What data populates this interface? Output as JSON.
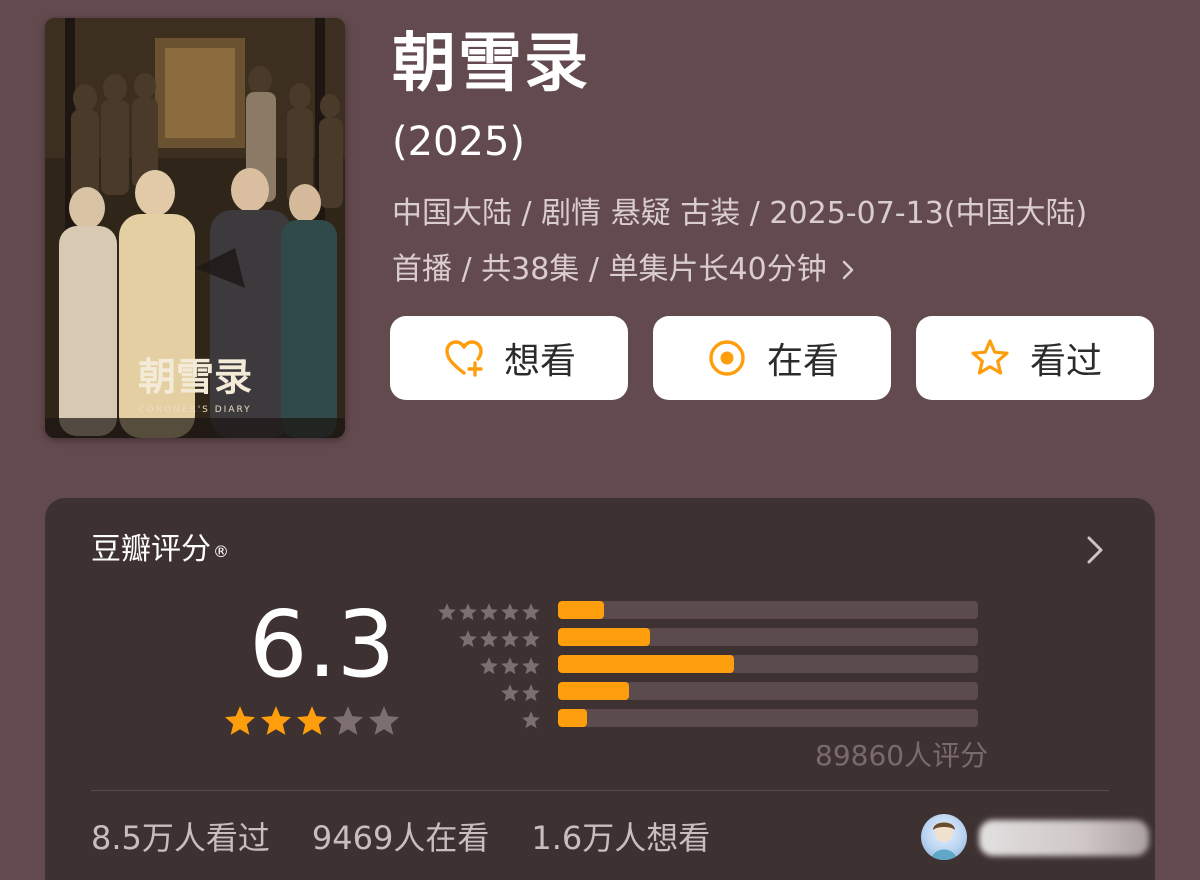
{
  "poster": {
    "calligraphy": "朝雪录",
    "english_title": "CORONER'S DIARY",
    "colors": {
      "light": "#e7d6b8",
      "gold": "#c8a46a",
      "dark": "#2b221a"
    }
  },
  "title": "朝雪录",
  "year": "(2025)",
  "meta_line1": "中国大陆 / 剧情 悬疑 古装 / 2025-07-13(中国大陆)",
  "meta_line2": "首播 / 共38集 / 单集片长40分钟",
  "buttons": {
    "want": {
      "label": "想看",
      "icon": "heart-plus-icon"
    },
    "watching": {
      "label": "在看",
      "icon": "target-circle-icon"
    },
    "watched": {
      "label": "看过",
      "icon": "star-outline-icon"
    }
  },
  "rating": {
    "title": "豆瓣评分",
    "registered": "®",
    "score": "6.3",
    "stars": 3,
    "max_stars": 5,
    "distribution": [
      {
        "stars": 5,
        "fraction": 0.11
      },
      {
        "stars": 4,
        "fraction": 0.22
      },
      {
        "stars": 3,
        "fraction": 0.42
      },
      {
        "stars": 2,
        "fraction": 0.17
      },
      {
        "stars": 1,
        "fraction": 0.07
      }
    ],
    "count_text": "89860人评分"
  },
  "stats": {
    "watched": "8.5万人看过",
    "watching": "9469人在看",
    "want": "1.6万人想看"
  },
  "colors": {
    "background": "#634a4e",
    "card": "#3e3131",
    "accent": "#ff9e0c",
    "star_on": "#ff9e0c",
    "star_off": "#7d6e70",
    "bar_track": "#5c4b4c"
  }
}
